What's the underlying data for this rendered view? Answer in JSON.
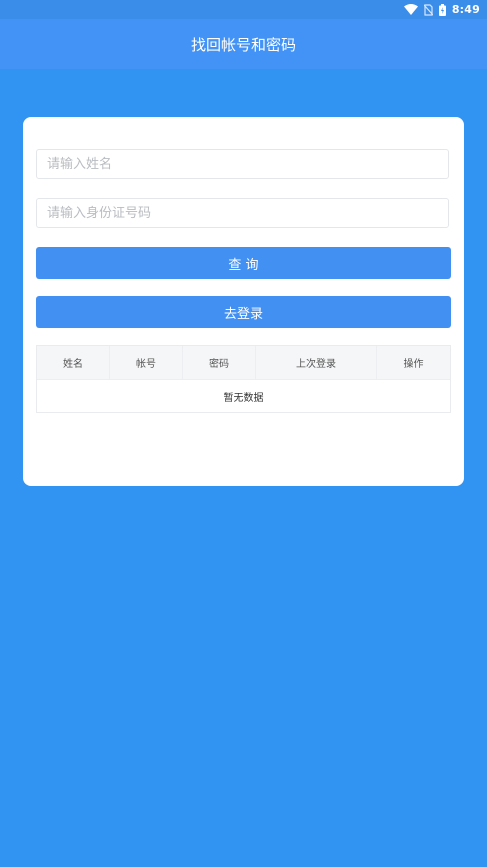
{
  "status_bar": {
    "time": "8:49"
  },
  "header": {
    "title": "找回帐号和密码"
  },
  "form": {
    "name_placeholder": "请输入姓名",
    "id_placeholder": "请输入身份证号码",
    "query_label": "查 询",
    "login_label": "去登录"
  },
  "table": {
    "columns": [
      "姓名",
      "帐号",
      "密码",
      "上次登录",
      "操作"
    ],
    "empty_text": "暂无数据"
  },
  "colors": {
    "background": "#3193f2",
    "header": "#4293f5",
    "button": "#4390f3"
  }
}
